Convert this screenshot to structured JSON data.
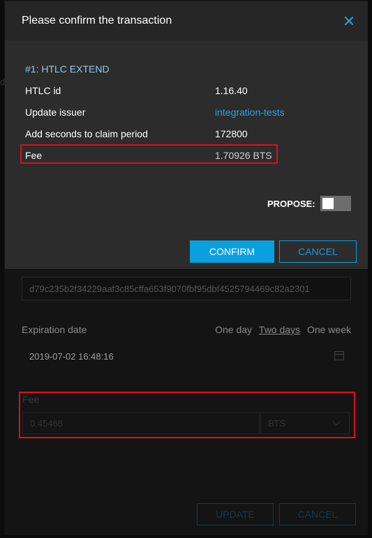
{
  "background": {
    "left_glyph": "d",
    "hash_value": "d79c235b2f34229aaf3c85cffa653f9070fbf95dbf4525794469c82a2301",
    "expiration_label": "Expiration date",
    "expiration_options": [
      "One day",
      "Two days",
      "One week"
    ],
    "expiration_selected": "Two days",
    "expiration_date": "2019-07-02 16:48:16",
    "fee_label": "Fee",
    "fee_amount": "0.45468",
    "fee_asset": "BTS",
    "update_label": "UPDATE",
    "cancel_label": "CANCEL"
  },
  "modal": {
    "title": "Please confirm the transaction",
    "operation_title": "#1: HTLC EXTEND",
    "rows": [
      {
        "label": "HTLC id",
        "value": "1.16.40"
      },
      {
        "label": "Update issuer",
        "value": "integration-tests"
      },
      {
        "label": "Add seconds to claim period",
        "value": "172800"
      },
      {
        "label": "Fee",
        "value": "1.70926 BTS"
      }
    ],
    "propose_label": "PROPOSE:",
    "propose_enabled": false,
    "confirm_label": "CONFIRM",
    "cancel_label": "CANCEL"
  },
  "colors": {
    "accent": "#0aa0e0",
    "highlight_box": "#d6121f",
    "modal_bg": "#2c2c2c"
  }
}
